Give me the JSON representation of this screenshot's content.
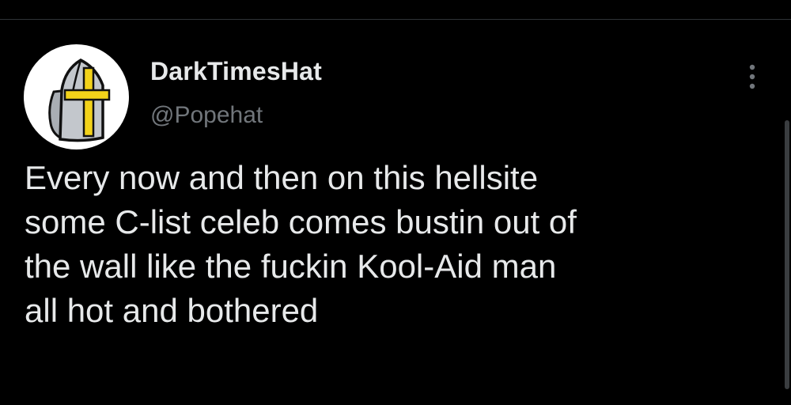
{
  "tweet": {
    "author": {
      "display_name": "DarkTimesHat",
      "handle": "@Popehat",
      "avatar_icon": "mitre-cross-icon"
    },
    "text": "Every now and then on this hellsite\nsome C-list celeb comes bustin out of\nthe wall like the fuckin Kool-Aid man\nall hot and bothered",
    "more_icon": "more-vertical-icon"
  },
  "colors": {
    "background": "#000000",
    "text_primary": "#e7e9ea",
    "text_secondary": "#71767b",
    "divider": "#2f3336",
    "avatar_mitre": "#c3c7cc",
    "avatar_cross": "#f2d21a"
  }
}
